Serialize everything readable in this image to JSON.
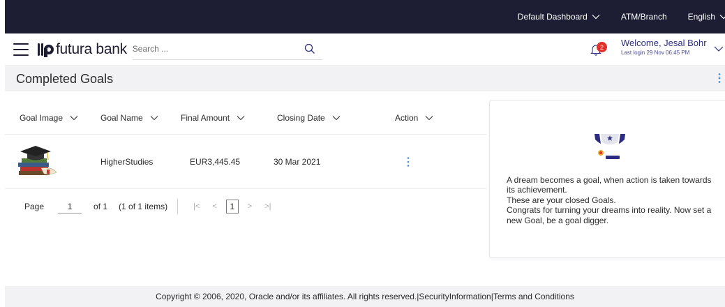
{
  "topbar": {
    "dashboard_label": "Default Dashboard",
    "atm_label": "ATM/Branch",
    "language_label": "English"
  },
  "header": {
    "logo_text": "futura bank",
    "search_placeholder": "Search ...",
    "notification_count": "2",
    "welcome": "Welcome, Jesal Bohr",
    "last_login": "Last login 29 Nov 06:45 PM"
  },
  "page": {
    "title": "Completed Goals"
  },
  "table": {
    "headers": [
      "Goal Image",
      "Goal Name",
      "Final Amount",
      "Closing Date",
      "Action"
    ],
    "rows": [
      {
        "goal_name": "HigherStudies",
        "final_amount": "EUR3,445.45",
        "closing_date": "30 Mar 2021"
      }
    ]
  },
  "pagination": {
    "page_label": "Page",
    "page_value": "1",
    "of_label": "of 1",
    "items_label": "(1 of 1 items)",
    "current_page": "1"
  },
  "info_card": {
    "line1": "A dream becomes a goal, when action is taken towards its achievement.",
    "line2": "These are your closed Goals.",
    "line3": "Congrats for turning your dreams into reality. Now set a new Goal, be a goal digger."
  },
  "footer": {
    "copyright": "Copyright © 2006, 2020, Oracle and/or its affiliates. All rights reserved.|SecurityInformation|Terms and Conditions"
  },
  "colors": {
    "topbar_bg": "#1d1d33",
    "accent": "#2e2e80",
    "badge": "#e0312b",
    "title_bar_bg": "#f2f2f5",
    "kebab": "#4a8fd6"
  }
}
